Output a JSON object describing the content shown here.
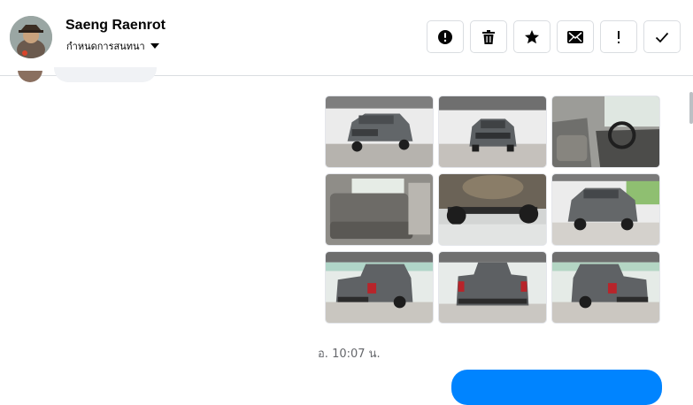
{
  "header": {
    "contact_name": "Saeng Raenrot",
    "subtitle": "กำหนดการสนทนา"
  },
  "actions": [
    {
      "icon": "alert-circle-icon",
      "label": "Report"
    },
    {
      "icon": "trash-icon",
      "label": "Delete"
    },
    {
      "icon": "star-icon",
      "label": "Star"
    },
    {
      "icon": "envelope-icon",
      "label": "Mark unread"
    },
    {
      "icon": "exclamation-icon",
      "label": "Priority"
    },
    {
      "icon": "checkmark-icon",
      "label": "Done"
    }
  ],
  "message": {
    "photos": [
      {
        "subject": "truck-front-showroom"
      },
      {
        "subject": "truck-front-center"
      },
      {
        "subject": "front-interior-dashboard"
      },
      {
        "subject": "rear-seats-interior"
      },
      {
        "subject": "truck-underside"
      },
      {
        "subject": "truck-front-angle-window"
      },
      {
        "subject": "truck-rear-left"
      },
      {
        "subject": "truck-rear-center"
      },
      {
        "subject": "truck-rear-right"
      }
    ],
    "timestamp": "อ. 10:07 น."
  },
  "colors": {
    "accent": "#0084ff",
    "border": "#dadde1",
    "muted_text": "#65676b"
  }
}
